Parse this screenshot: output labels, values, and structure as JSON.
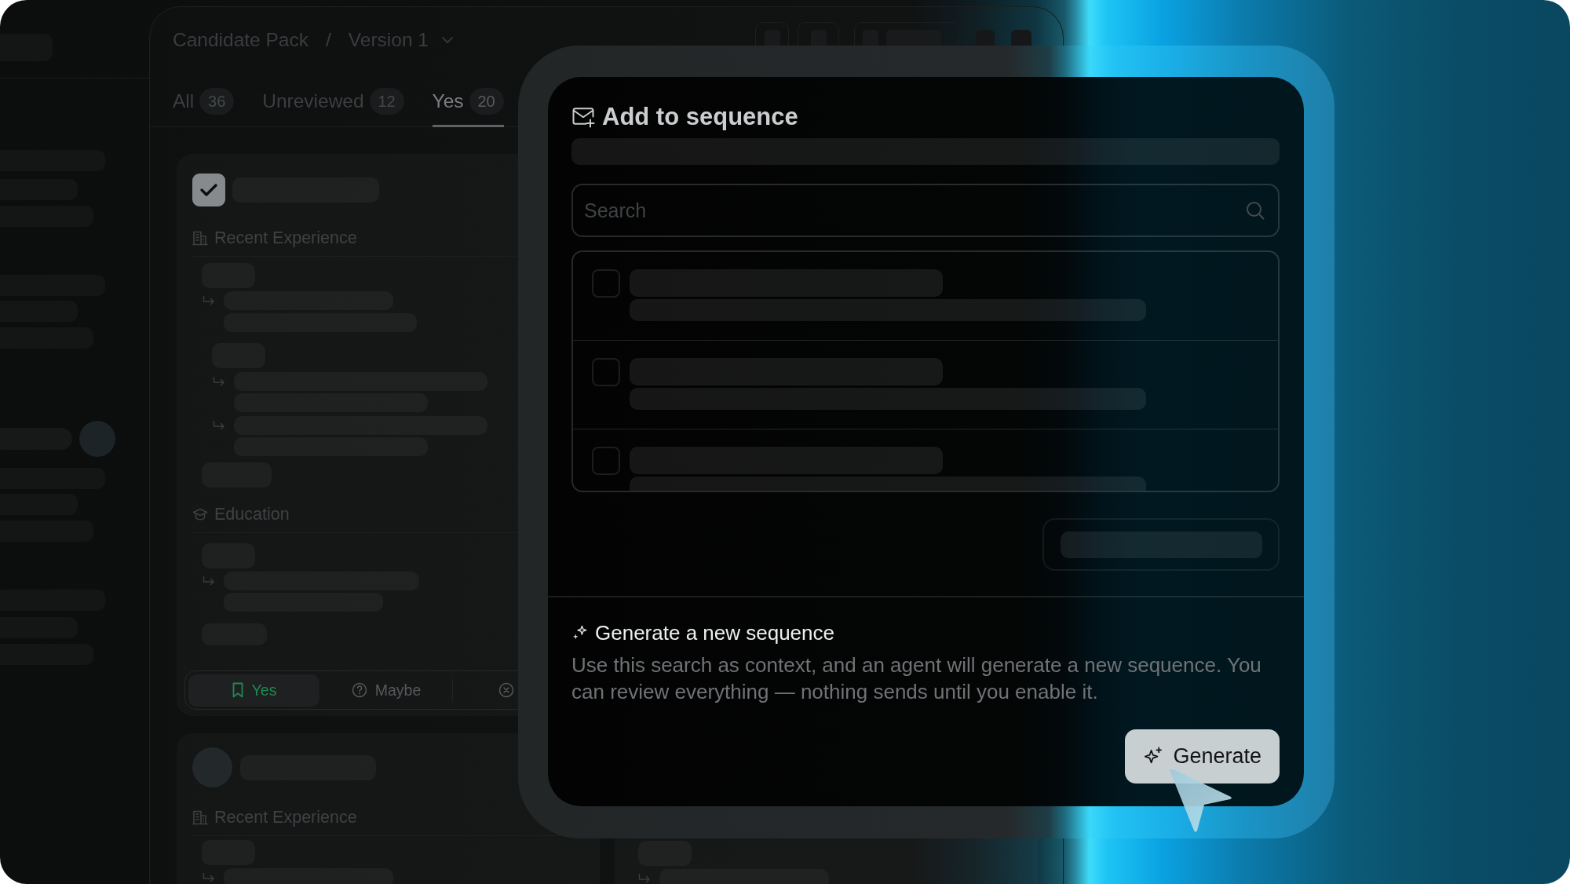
{
  "breadcrumb": {
    "parent": "Candidate Pack",
    "separator": "/",
    "current": "Version 1"
  },
  "tabs": [
    {
      "label": "All",
      "count": "36",
      "selected": false
    },
    {
      "label": "Unreviewed",
      "count": "12",
      "selected": false
    },
    {
      "label": "Yes",
      "count": "20",
      "selected": true
    }
  ],
  "cards": [
    {
      "kind": "checkbox",
      "checked": true,
      "sections": [
        {
          "kind": "experience",
          "title": "Recent Experience"
        },
        {
          "kind": "education",
          "title": "Education"
        }
      ],
      "decisions": [
        {
          "kind": "yes",
          "label": "Yes",
          "selected": true
        },
        {
          "kind": "maybe",
          "label": "Maybe",
          "selected": false
        },
        {
          "kind": "reject",
          "selected": false
        }
      ]
    },
    {
      "kind": "avatar",
      "sections": [
        {
          "kind": "experience",
          "title": "Recent Experience"
        }
      ]
    }
  ],
  "modal": {
    "title": "Add to sequence",
    "search": {
      "placeholder": "Search"
    },
    "sequence_rows": [
      {
        "checked": false
      },
      {
        "checked": false
      },
      {
        "checked": false
      }
    ],
    "generate": {
      "heading": "Generate a new sequence",
      "description": "Use this search as context, and an agent will generate a new sequence. You can review everything — nothing sends until you enable it.",
      "button": "Generate"
    }
  }
}
